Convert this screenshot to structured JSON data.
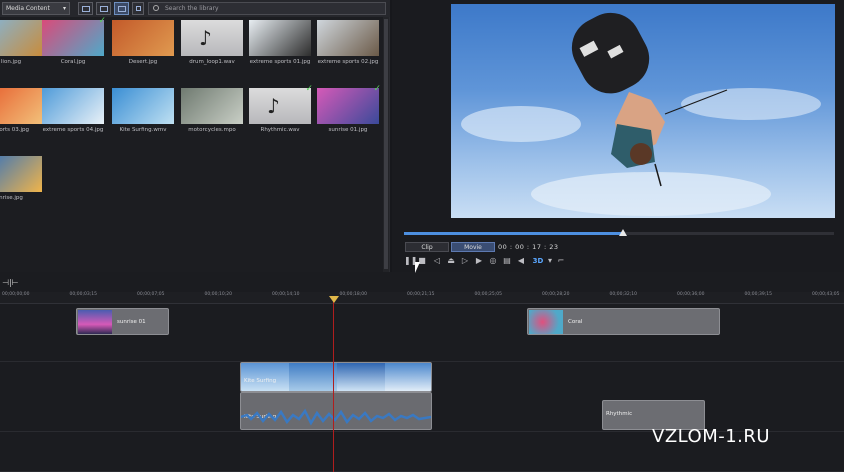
{
  "library": {
    "dropdown": "Media Content",
    "search_placeholder": "Search the library",
    "items": [
      {
        "name": "lion.jpg",
        "label": "lion.jpg",
        "checked": false,
        "kind": "image",
        "colors": [
          "#7fb8e2",
          "#c88c3c"
        ]
      },
      {
        "name": "Coral",
        "label": "Coral.jpg",
        "checked": true,
        "kind": "image",
        "colors": [
          "#d94b7a",
          "#4fa9c9"
        ]
      },
      {
        "name": "Desert",
        "label": "Desert.jpg",
        "checked": false,
        "kind": "image",
        "colors": [
          "#c35a2a",
          "#e09a50"
        ]
      },
      {
        "name": "drum_loop",
        "label": "drum_loop1.wav",
        "checked": false,
        "kind": "audio",
        "colors": [
          "#dcdcdc",
          "#b8b8bb"
        ]
      },
      {
        "name": "extreme-sports-01",
        "label": "extreme sports 01.jpg",
        "checked": false,
        "kind": "image",
        "colors": [
          "#e8eef2",
          "#2d2d2d"
        ]
      },
      {
        "name": "extreme-sports-02",
        "label": "extreme sports 02.jpg",
        "checked": false,
        "kind": "image",
        "colors": [
          "#cfd6dc",
          "#6b5a48"
        ]
      },
      {
        "name": "extreme-sports-03",
        "label": "sports 03.jpg",
        "checked": false,
        "kind": "image",
        "colors": [
          "#e65b2b",
          "#f2c07a"
        ]
      },
      {
        "name": "extreme-sports-04",
        "label": "extreme sports 04.jpg",
        "checked": false,
        "kind": "image",
        "colors": [
          "#4f9bd9",
          "#e9f1f7"
        ]
      },
      {
        "name": "kite-surfing",
        "label": "Kite Surfing.wmv",
        "checked": false,
        "kind": "image",
        "colors": [
          "#3a8ed4",
          "#bfe0f2"
        ]
      },
      {
        "name": "motorcycles",
        "label": "motorcycles.mpo",
        "checked": false,
        "kind": "image",
        "colors": [
          "#6f7a70",
          "#c9cfc6"
        ],
        "badge": "3D"
      },
      {
        "name": "rhythmic",
        "label": "Rhythmic.wav",
        "checked": true,
        "kind": "audio",
        "colors": [
          "#dcdcdc",
          "#b8b8bb"
        ]
      },
      {
        "name": "sunrise-01",
        "label": "sunrise 01.jpg",
        "checked": true,
        "kind": "image",
        "colors": [
          "#d65ab8",
          "#3a4a9a"
        ]
      },
      {
        "name": "sunrise",
        "label": "nrise.jpg",
        "checked": false,
        "kind": "image",
        "colors": [
          "#2c6fc2",
          "#f0b44a"
        ]
      }
    ]
  },
  "preview": {
    "tabs": [
      "Clip",
      "Movie"
    ],
    "active_tab": "Movie",
    "timecode": "00 : 00 : 17 : 23",
    "progress": 0.51,
    "mode_3d": "3D"
  },
  "timeline": {
    "ruler": [
      "00;00;00;00",
      "00;00;03;15",
      "00;00;07;05",
      "00;00;10;20",
      "00;00;14;10",
      "00;00;18;00",
      "00;00;21;15",
      "00;00;25;05",
      "00;00;28;20",
      "00;00;32;10",
      "00;00;36;00",
      "00;00;39;15",
      "00;00;43;05"
    ],
    "clips": {
      "sunrise": "sunrise 01",
      "coral": "Coral",
      "kite_video": "Kite Surfing",
      "kite_audio": "Kite Surfing",
      "rhythmic": "Rhythmic"
    }
  },
  "watermark": "VZLOM-1.RU",
  "colors": {
    "accent": "#4d8fe0",
    "playhead": "#b01e1e",
    "check": "#57d05a"
  }
}
